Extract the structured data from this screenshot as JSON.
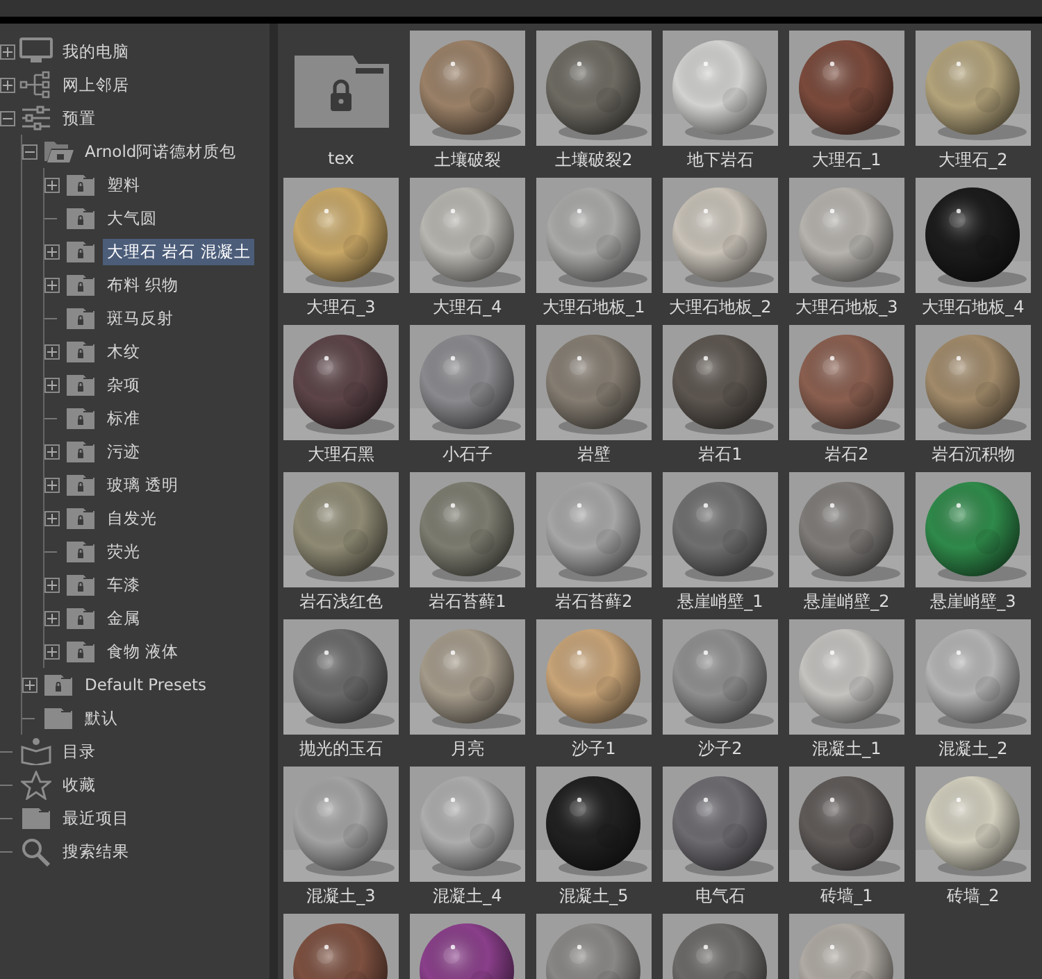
{
  "tree": [
    {
      "label": "我的电脑",
      "kind": "monitor",
      "expanded": false,
      "selected": false
    },
    {
      "label": "网上邻居",
      "kind": "network",
      "expanded": false,
      "selected": false
    },
    {
      "label": "预置",
      "kind": "sliders",
      "expanded": true,
      "selected": false,
      "children": [
        {
          "label": "Arnold阿诺德材质包",
          "kind": "open-locked-folder",
          "expanded": true,
          "selected": false,
          "children": [
            {
              "label": "塑料",
              "kind": "locked-folder",
              "expanded": false,
              "selected": false
            },
            {
              "label": "大气圆",
              "kind": "locked-folder",
              "selected": false
            },
            {
              "label": "大理石 岩石 混凝土",
              "kind": "locked-folder",
              "expanded": false,
              "selected": true
            },
            {
              "label": "布料 织物",
              "kind": "locked-folder",
              "expanded": false,
              "selected": false
            },
            {
              "label": "斑马反射",
              "kind": "locked-folder",
              "selected": false
            },
            {
              "label": "木纹",
              "kind": "locked-folder",
              "expanded": false,
              "selected": false
            },
            {
              "label": "杂项",
              "kind": "locked-folder",
              "expanded": false,
              "selected": false
            },
            {
              "label": "标准",
              "kind": "locked-folder",
              "selected": false
            },
            {
              "label": "污迹",
              "kind": "locked-folder",
              "expanded": false,
              "selected": false
            },
            {
              "label": "玻璃 透明",
              "kind": "locked-folder",
              "expanded": false,
              "selected": false
            },
            {
              "label": "自发光",
              "kind": "locked-folder",
              "expanded": false,
              "selected": false
            },
            {
              "label": "荧光",
              "kind": "locked-folder",
              "selected": false
            },
            {
              "label": "车漆",
              "kind": "locked-folder",
              "expanded": false,
              "selected": false
            },
            {
              "label": "金属",
              "kind": "locked-folder",
              "expanded": false,
              "selected": false
            },
            {
              "label": "食物 液体",
              "kind": "locked-folder",
              "expanded": false,
              "selected": false
            }
          ]
        },
        {
          "label": "Default Presets",
          "kind": "locked-folder",
          "expanded": false,
          "selected": false
        },
        {
          "label": "默认",
          "kind": "folder",
          "selected": false
        }
      ]
    },
    {
      "label": "目录",
      "kind": "book",
      "selected": false
    },
    {
      "label": "收藏",
      "kind": "star",
      "selected": false
    },
    {
      "label": "最近项目",
      "kind": "folder",
      "selected": false
    },
    {
      "label": "搜索结果",
      "kind": "search",
      "selected": false
    }
  ],
  "tiles": [
    {
      "kind": "folder",
      "label": "tex"
    },
    {
      "kind": "picture",
      "label": "土壤破裂"
    },
    {
      "kind": "picture",
      "label": "土壤破裂2"
    },
    {
      "kind": "picture",
      "label": "地下岩石"
    },
    {
      "kind": "picture",
      "label": "大理石_1"
    },
    {
      "kind": "picture",
      "label": "大理石_2"
    },
    {
      "kind": "picture",
      "label": "大理石_3"
    },
    {
      "kind": "picture",
      "label": "大理石_4"
    },
    {
      "kind": "picture",
      "label": "大理石地板_1"
    },
    {
      "kind": "picture",
      "label": "大理石地板_2"
    },
    {
      "kind": "picture",
      "label": "大理石地板_3"
    },
    {
      "kind": "picture",
      "label": "大理石地板_4"
    },
    {
      "kind": "picture",
      "label": "大理石黑"
    },
    {
      "kind": "picture",
      "label": "小石子"
    },
    {
      "kind": "picture",
      "label": "岩壁"
    },
    {
      "kind": "picture",
      "label": "岩石1"
    },
    {
      "kind": "picture",
      "label": "岩石2"
    },
    {
      "kind": "picture",
      "label": "岩石沉积物"
    },
    {
      "kind": "picture",
      "label": "岩石浅红色"
    },
    {
      "kind": "picture",
      "label": "岩石苔藓1"
    },
    {
      "kind": "picture",
      "label": "岩石苔藓2"
    },
    {
      "kind": "picture",
      "label": "悬崖峭壁_1"
    },
    {
      "kind": "picture",
      "label": "悬崖峭壁_2"
    },
    {
      "kind": "picture",
      "label": "悬崖峭壁_3"
    },
    {
      "kind": "picture",
      "label": "抛光的玉石"
    },
    {
      "kind": "picture",
      "label": "月亮"
    },
    {
      "kind": "picture",
      "label": "沙子1"
    },
    {
      "kind": "picture",
      "label": "沙子2"
    },
    {
      "kind": "picture",
      "label": "混凝土_1"
    },
    {
      "kind": "picture",
      "label": "混凝土_2"
    },
    {
      "kind": "picture",
      "label": "混凝土_3"
    },
    {
      "kind": "picture",
      "label": "混凝土_4"
    },
    {
      "kind": "picture",
      "label": "混凝土_5"
    },
    {
      "kind": "picture",
      "label": "电气石"
    },
    {
      "kind": "picture",
      "label": "砖墙_1"
    },
    {
      "kind": "picture",
      "label": "砖墙_2"
    },
    {
      "kind": "picture"
    },
    {
      "kind": "picture"
    },
    {
      "kind": "picture"
    },
    {
      "kind": "picture"
    },
    {
      "kind": "picture"
    }
  ]
}
